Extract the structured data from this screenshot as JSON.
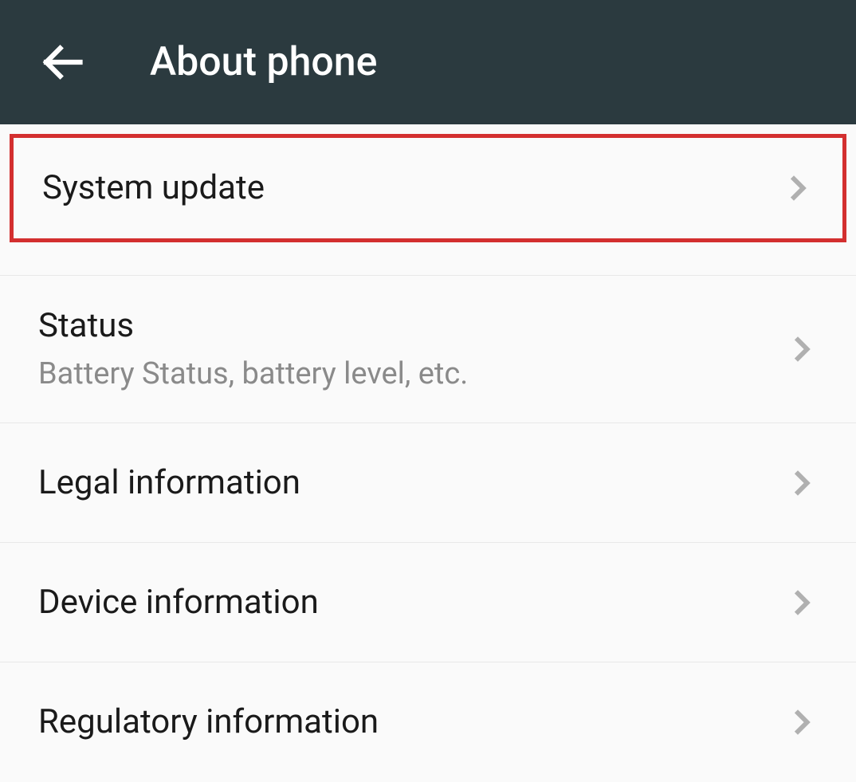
{
  "header": {
    "title": "About phone"
  },
  "items": [
    {
      "title": "System update",
      "subtitle": null,
      "highlighted": true
    },
    {
      "title": "Status",
      "subtitle": "Battery Status, battery level, etc.",
      "highlighted": false
    },
    {
      "title": "Legal information",
      "subtitle": null,
      "highlighted": false
    },
    {
      "title": "Device information",
      "subtitle": null,
      "highlighted": false
    },
    {
      "title": "Regulatory information",
      "subtitle": null,
      "highlighted": false
    }
  ]
}
